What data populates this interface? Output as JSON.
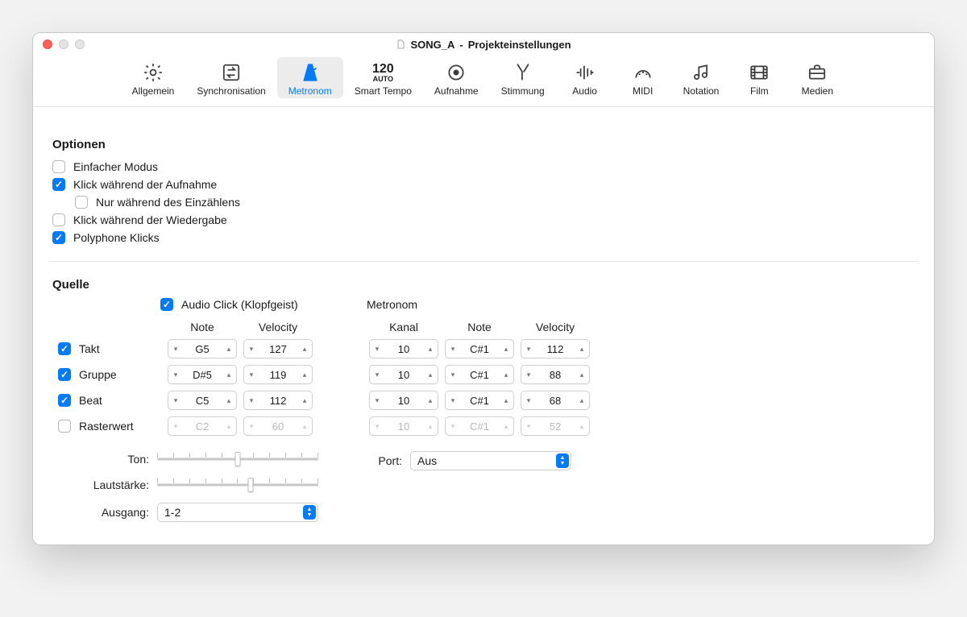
{
  "window": {
    "title_prefix": "SONG_A",
    "title_suffix": "Projekteinstellungen"
  },
  "toolbar": {
    "items": [
      {
        "label": "Allgemein"
      },
      {
        "label": "Synchronisation"
      },
      {
        "label": "Metronom"
      },
      {
        "label": "Smart Tempo",
        "tempo_big": "120",
        "tempo_small": "AUTO"
      },
      {
        "label": "Aufnahme"
      },
      {
        "label": "Stimmung"
      },
      {
        "label": "Audio"
      },
      {
        "label": "MIDI"
      },
      {
        "label": "Notation"
      },
      {
        "label": "Film"
      },
      {
        "label": "Medien"
      }
    ],
    "active_index": 2
  },
  "sections": {
    "options_title": "Optionen",
    "source_title": "Quelle"
  },
  "options": {
    "simple_mode": {
      "label": "Einfacher Modus",
      "checked": false
    },
    "click_record": {
      "label": "Klick während der Aufnahme",
      "checked": true
    },
    "only_countin": {
      "label": "Nur während des Einzählens",
      "checked": false
    },
    "click_playback": {
      "label": "Klick während der Wiedergabe",
      "checked": false
    },
    "polyphonic": {
      "label": "Polyphone Klicks",
      "checked": true
    }
  },
  "source": {
    "audio_click": {
      "label": "Audio Click (Klopfgeist)",
      "checked": true
    },
    "metronome_label": "Metronom",
    "col_note": "Note",
    "col_velocity": "Velocity",
    "col_channel": "Kanal",
    "rows": [
      {
        "key": "takt",
        "label": "Takt",
        "checked": true,
        "note": "G5",
        "vel": "127",
        "ch": "10",
        "mnote": "C#1",
        "mvel": "112"
      },
      {
        "key": "gruppe",
        "label": "Gruppe",
        "checked": true,
        "note": "D#5",
        "vel": "119",
        "ch": "10",
        "mnote": "C#1",
        "mvel": "88"
      },
      {
        "key": "beat",
        "label": "Beat",
        "checked": true,
        "note": "C5",
        "vel": "112",
        "ch": "10",
        "mnote": "C#1",
        "mvel": "68"
      },
      {
        "key": "raster",
        "label": "Rasterwert",
        "checked": false,
        "note": "C2",
        "vel": "60",
        "ch": "10",
        "mnote": "C#1",
        "mvel": "52"
      }
    ],
    "tone_label": "Ton:",
    "tone_value_pct": 50,
    "volume_label": "Lautstärke:",
    "volume_value_pct": 58,
    "output_label": "Ausgang:",
    "output_value": "1-2",
    "port_label": "Port:",
    "port_value": "Aus"
  }
}
